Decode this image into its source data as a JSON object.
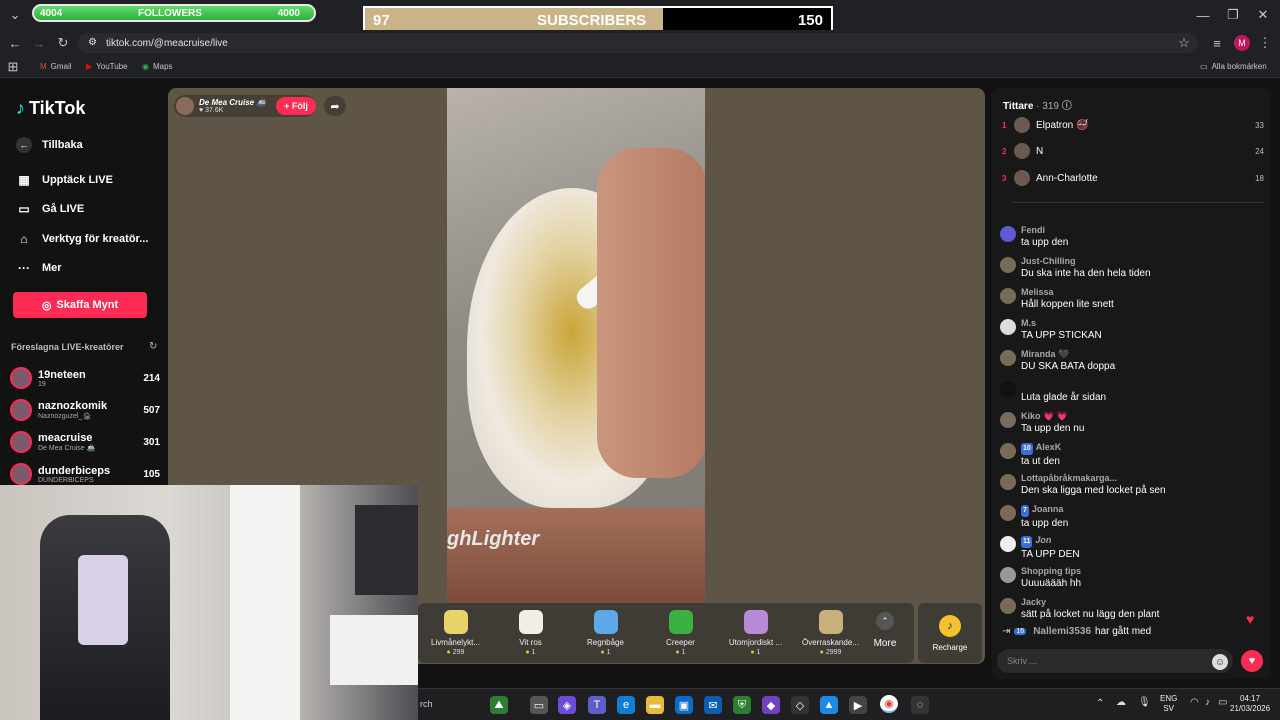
{
  "overlay": {
    "followers": {
      "left_value": "4004",
      "label": "FOLLOWERS",
      "right_value": "4000"
    },
    "subscribers": {
      "left_value": "97",
      "label": "SUBSCRIBERS",
      "right_value": "150",
      "progress": 0.64
    }
  },
  "browser": {
    "url": "tiktok.com/@meacruise/live",
    "bookmarks": [
      "Gmail",
      "YouTube",
      "Maps"
    ],
    "all_bookmarks": "Alla bokmärken",
    "profile_initial": "M"
  },
  "sidebar": {
    "logo": "TikTok",
    "back": "Tillbaka",
    "items": [
      {
        "label": "Upptäck LIVE",
        "icon": "calendar-icon"
      },
      {
        "label": "Gå LIVE",
        "icon": "camera-icon"
      },
      {
        "label": "Verktyg för kreatör...",
        "icon": "tools-icon"
      },
      {
        "label": "Mer",
        "icon": "more-icon"
      }
    ],
    "coins_button": "Skaffa Mynt",
    "suggested_title": "Föreslagna LIVE-kreatörer",
    "creators": [
      {
        "name": "19neteen",
        "sub": "19",
        "count": "214"
      },
      {
        "name": "naznozkomik",
        "sub": "Naznozguzel_🏚",
        "count": "507"
      },
      {
        "name": "meacruise",
        "sub": "De Mea Cruise 🚢",
        "count": "301"
      },
      {
        "name": "dunderbiceps",
        "sub": "DUNDERBICEPS",
        "count": "105"
      }
    ]
  },
  "stream": {
    "host_name": "De Mea Cruise 🚢",
    "host_likes": "37.6K",
    "follow_label": "+ Följ",
    "video_text": "ghLighter"
  },
  "gifts": [
    {
      "name": "Livmånelykt...",
      "cost": "299",
      "color": "#e8d26a"
    },
    {
      "name": "Vit ros",
      "cost": "1",
      "color": "#f2efe6"
    },
    {
      "name": "Regnbåge",
      "cost": "1",
      "color": "#5fa8e8"
    },
    {
      "name": "Creeper",
      "cost": "1",
      "color": "#3cb043"
    },
    {
      "name": "Utomjordiskt ...",
      "cost": "1",
      "color": "#b889d6"
    },
    {
      "name": "Överraskande...",
      "cost": "2999",
      "color": "#c9b07a"
    }
  ],
  "gift_more": "More",
  "recharge": "Recharge",
  "chat": {
    "viewers_label": "Tittare",
    "viewers_count": "· 319",
    "top_viewers": [
      {
        "rank": "1",
        "name": "Elpatron 🚭",
        "score": "33"
      },
      {
        "rank": "2",
        "name": "N",
        "score": "24"
      },
      {
        "rank": "3",
        "name": "Ann-Charlotte",
        "score": "18"
      }
    ],
    "messages": [
      {
        "user": "Fendi",
        "text": "ta upp den",
        "badge": ""
      },
      {
        "user": "Just-Chilling",
        "text": "Du ska inte ha den hela tiden",
        "badge": ""
      },
      {
        "user": "Melissa",
        "text": "Håll koppen lite snett",
        "badge": ""
      },
      {
        "user": "M.s",
        "text": "TA UPP STICKAN",
        "badge": ""
      },
      {
        "user": "Miranda 🖤",
        "text": "DU SKA BATA doppa",
        "badge": ""
      },
      {
        "user": "",
        "text": "Luta glade år sidan",
        "badge": ""
      },
      {
        "user": "Kiko 💗 💗",
        "text": "Ta upp den nu",
        "badge": ""
      },
      {
        "user": "AlexK",
        "text": "ta ut den",
        "badge": "10"
      },
      {
        "user": "Lottapåbråkmakarga...",
        "text": "Den ska ligga med locket på sen",
        "badge": ""
      },
      {
        "user": "Joanna",
        "text": "ta upp den",
        "badge": "7"
      },
      {
        "user": "Jon",
        "text": "TA UPP DEN",
        "badge": "11"
      },
      {
        "user": "Shopping tips",
        "text": "Uuuuäääh hh",
        "badge": ""
      },
      {
        "user": "Jacky",
        "text": "sätt på locket nu lägg den plant",
        "badge": ""
      }
    ],
    "join_badge": "16",
    "join_user": "Nallemi3536",
    "join_text": "har gått med",
    "input_placeholder": "Skriv ..."
  },
  "taskbar": {
    "search_text": "rch",
    "lang": "ENG",
    "region": "SV",
    "time": "04:17",
    "date": "21/03/2026"
  }
}
